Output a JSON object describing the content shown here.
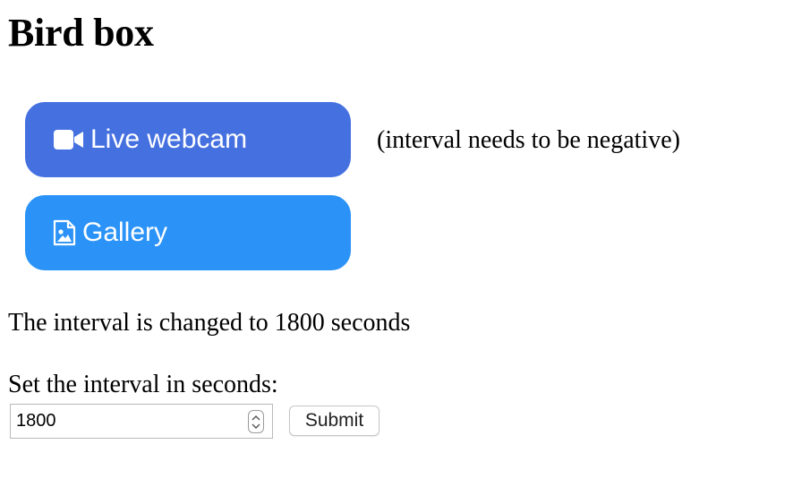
{
  "page": {
    "title": "Bird box"
  },
  "buttons": {
    "webcam": {
      "label": "Live webcam",
      "icon": "video-camera-icon",
      "color": "#4570e0"
    },
    "gallery": {
      "label": "Gallery",
      "icon": "image-file-icon",
      "color": "#2b93f7"
    }
  },
  "note": "(interval needs to be negative)",
  "status": "The interval is changed to 1800 seconds",
  "form": {
    "label": "Set the interval in seconds:",
    "input_value": "1800",
    "submit_label": "Submit"
  }
}
